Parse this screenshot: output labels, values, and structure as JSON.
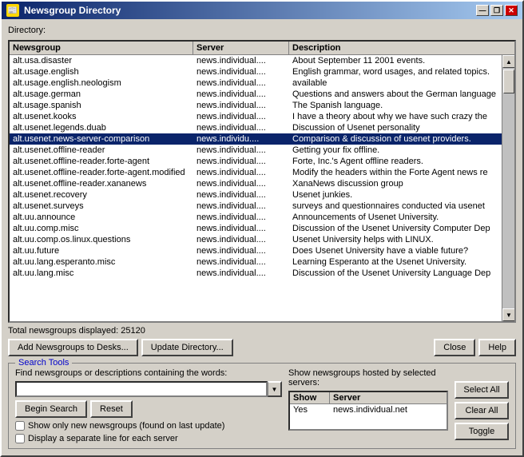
{
  "window": {
    "title": "Newsgroup Directory",
    "title_icon": "📰"
  },
  "title_buttons": {
    "minimize": "—",
    "restore": "❐",
    "close": "✕"
  },
  "directory_label": "Directory:",
  "table": {
    "headers": [
      "Newsgroup",
      "Server",
      "Description"
    ],
    "rows": [
      {
        "newsgroup": "alt.usa.disaster",
        "server": "news.individual....",
        "description": "About September 11 2001 events.",
        "selected": false
      },
      {
        "newsgroup": "alt.usage.english",
        "server": "news.individual....",
        "description": "English grammar, word usages, and related topics.",
        "selected": false
      },
      {
        "newsgroup": "alt.usage.english.neologism",
        "server": "news.individual....",
        "description": "available",
        "selected": false
      },
      {
        "newsgroup": "alt.usage.german",
        "server": "news.individual....",
        "description": "Questions and answers about the German language",
        "selected": false
      },
      {
        "newsgroup": "alt.usage.spanish",
        "server": "news.individual....",
        "description": "The Spanish language.",
        "selected": false
      },
      {
        "newsgroup": "alt.usenet.kooks",
        "server": "news.individual....",
        "description": "I have a theory about why we have such crazy the",
        "selected": false
      },
      {
        "newsgroup": "alt.usenet.legends.duab",
        "server": "news.individual....",
        "description": "Discussion of Usenet personality",
        "selected": false
      },
      {
        "newsgroup": "alt.usenet.news-server-comparison",
        "server": "news.individu....",
        "description": "Comparison & discussion of usenet providers.",
        "selected": true
      },
      {
        "newsgroup": "alt.usenet.offline-reader",
        "server": "news.individual....",
        "description": "Getting your fix offline.",
        "selected": false
      },
      {
        "newsgroup": "alt.usenet.offline-reader.forte-agent",
        "server": "news.individual....",
        "description": "Forte, Inc.'s Agent offline readers.",
        "selected": false
      },
      {
        "newsgroup": "alt.usenet.offline-reader.forte-agent.modified",
        "server": "news.individual....",
        "description": "Modify the headers within the Forte Agent news re",
        "selected": false
      },
      {
        "newsgroup": "alt.usenet.offline-reader.xananews",
        "server": "news.individual....",
        "description": "XanaNews discussion group",
        "selected": false
      },
      {
        "newsgroup": "alt.usenet.recovery",
        "server": "news.individual....",
        "description": "Usenet junkies.",
        "selected": false
      },
      {
        "newsgroup": "alt.usenet.surveys",
        "server": "news.individual....",
        "description": "surveys and questionnaires conducted via usenet",
        "selected": false
      },
      {
        "newsgroup": "alt.uu.announce",
        "server": "news.individual....",
        "description": "Announcements of Usenet University.",
        "selected": false
      },
      {
        "newsgroup": "alt.uu.comp.misc",
        "server": "news.individual....",
        "description": "Discussion of the Usenet University Computer Dep",
        "selected": false
      },
      {
        "newsgroup": "alt.uu.comp.os.linux.questions",
        "server": "news.individual....",
        "description": "Usenet University helps with LINUX.",
        "selected": false
      },
      {
        "newsgroup": "alt.uu.future",
        "server": "news.individual....",
        "description": "Does Usenet University have a viable future?",
        "selected": false
      },
      {
        "newsgroup": "alt.uu.lang.esperanto.misc",
        "server": "news.individual....",
        "description": "Learning Esperanto at the Usenet University.",
        "selected": false
      },
      {
        "newsgroup": "alt.uu.lang.misc",
        "server": "news.individual....",
        "description": "Discussion of the Usenet University Language Dep",
        "selected": false
      }
    ]
  },
  "total_newsgroups": "Total newsgroups displayed: 25120",
  "buttons": {
    "add_newsgroups": "Add Newsgroups to Desks...",
    "update_directory": "Update Directory...",
    "close": "Close",
    "help": "Help"
  },
  "search_tools": {
    "label": "Search Tools",
    "find_label": "Find newsgroups or descriptions containing the words:",
    "search_input_placeholder": "",
    "search_input_value": "",
    "begin_search": "Begin Search",
    "reset": "Reset",
    "show_only_new": "Show only new newsgroups (found on last update)",
    "separate_line": "Display a separate line for each server",
    "show_newsgroups_label": "Show newsgroups hosted by selected servers:",
    "server_table": {
      "headers": [
        "Show",
        "Server"
      ],
      "rows": [
        {
          "show": "Yes",
          "server": "news.individual.net"
        }
      ]
    },
    "select_all": "Select All",
    "clear_all": "Clear All",
    "toggle": "Toggle"
  }
}
